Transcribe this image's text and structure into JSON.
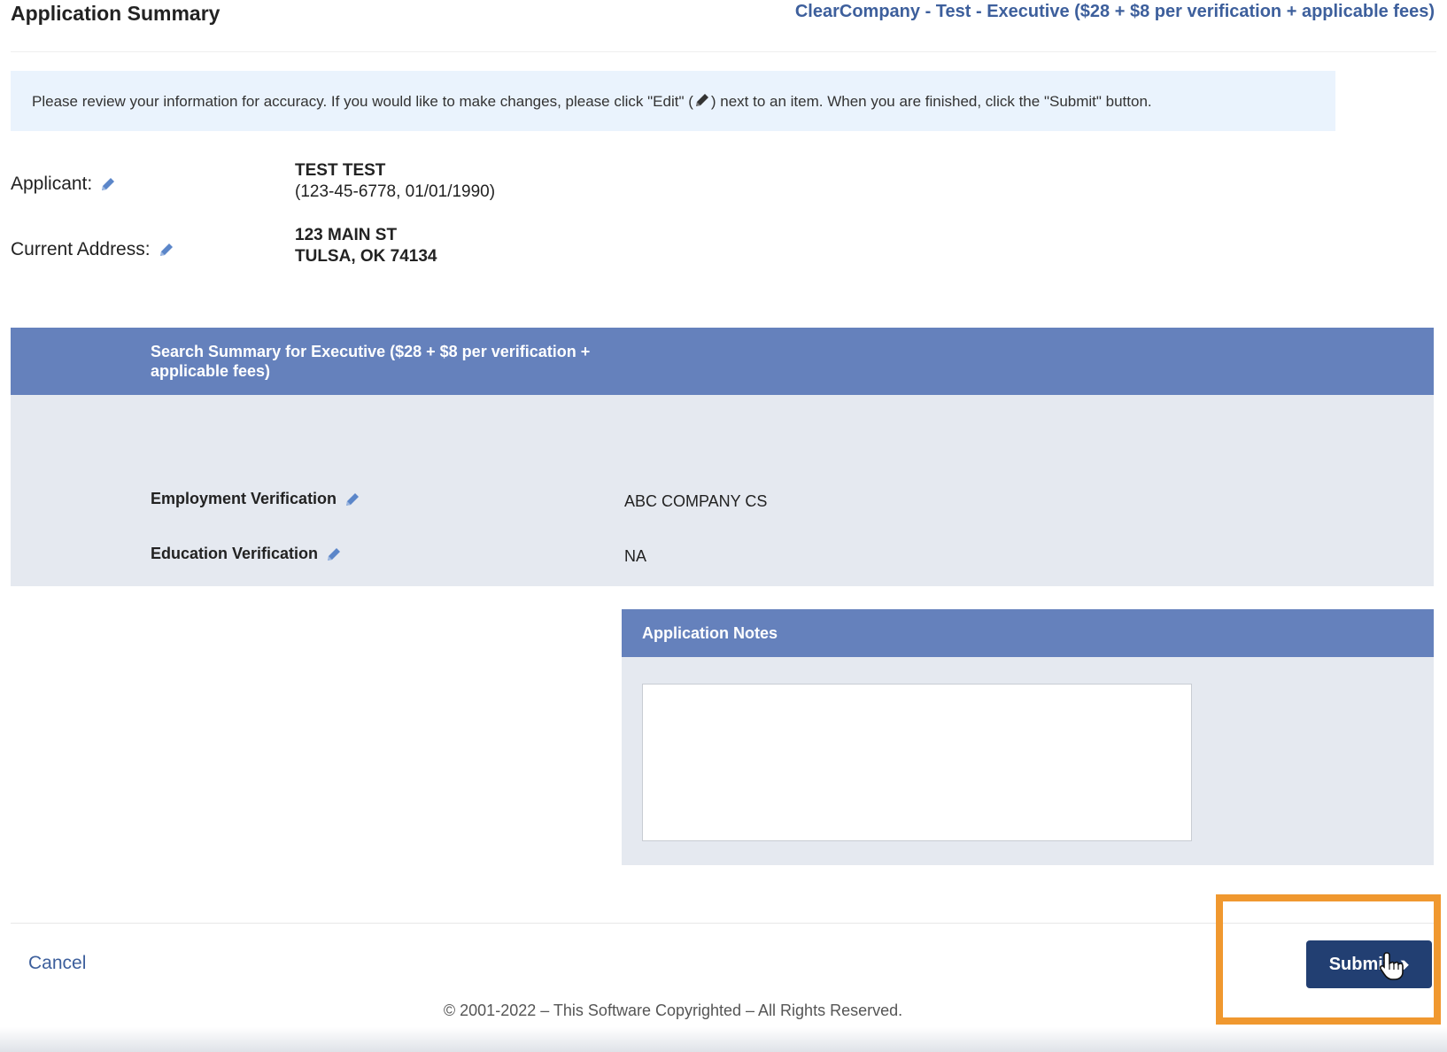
{
  "header": {
    "title": "Application Summary",
    "package": "ClearCompany - Test - Executive ($28 + $8 per verification + applicable fees)"
  },
  "notice": {
    "text_before": "Please review your information for accuracy. If you would like to make changes, please click \"Edit\" (",
    "text_after": ") next to an item. When you are finished, click the \"Submit\" button."
  },
  "applicant": {
    "label": "Applicant:",
    "name": "TEST TEST",
    "details": "(123-45-6778, 01/01/1990)"
  },
  "address": {
    "label": "Current Address:",
    "line1": "123 MAIN ST",
    "line2": "TULSA, OK 74134"
  },
  "search_summary": {
    "title": "Search Summary for Executive ($28 + $8 per verification + applicable fees)",
    "rows": [
      {
        "label": "Employment Verification",
        "value": "ABC COMPANY CS"
      },
      {
        "label": "Education Verification",
        "value": "NA"
      }
    ]
  },
  "notes": {
    "title": "Application Notes",
    "value": ""
  },
  "footer": {
    "cancel_label": "Cancel",
    "submit_label": "Submit",
    "copyright": "© 2001-2022 – This Software Copyrighted – All Rights Reserved."
  },
  "colors": {
    "panel_header": "#6581bc",
    "panel_body": "#e5e9f0",
    "submit_button": "#223f72",
    "highlight_box": "#f0982f",
    "link": "#3d5f9c"
  },
  "icons": {
    "edit": "pencil-icon",
    "cursor": "hand-pointer-icon"
  }
}
